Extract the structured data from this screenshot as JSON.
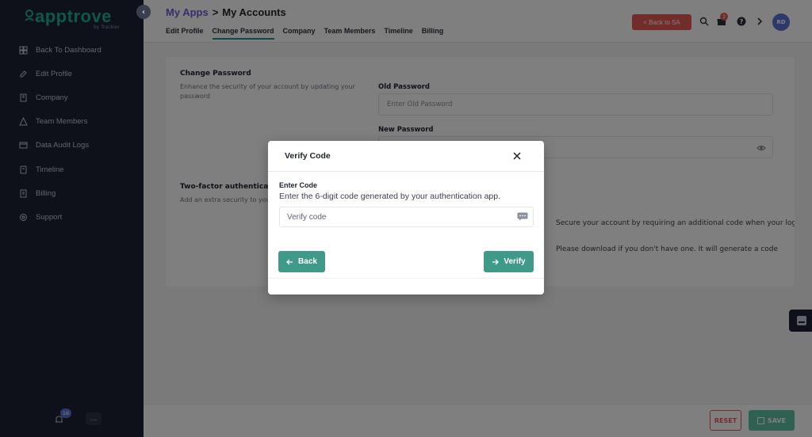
{
  "sidebar": {
    "logo_text": "apptrove",
    "logo_sub": "by Trackier",
    "items": [
      {
        "label": "Back To Dashboard",
        "icon": "dashboard-icon"
      },
      {
        "label": "Edit Profile",
        "icon": "edit-icon"
      },
      {
        "label": "Company",
        "icon": "building-icon"
      },
      {
        "label": "Team Members",
        "icon": "team-icon"
      },
      {
        "label": "Data Audit Logs",
        "icon": "audit-icon"
      },
      {
        "label": "Timeline",
        "icon": "timeline-icon"
      },
      {
        "label": "Billing",
        "icon": "billing-icon"
      },
      {
        "label": "Support",
        "icon": "support-icon"
      }
    ],
    "notification_count": "16",
    "more_label": "..."
  },
  "header": {
    "breadcrumb_link": "My Apps",
    "breadcrumb_sep": ">",
    "breadcrumb_current": "My Accounts",
    "tabs": [
      "Edit Profile",
      "Change Password",
      "Company",
      "Team Members",
      "Timeline",
      "Billing"
    ],
    "active_tab": "Change Password",
    "back_to_sa": "< Back to SA",
    "gift_badge": "2",
    "avatar_initials": "RD"
  },
  "change_password": {
    "title": "Change Password",
    "description": "Enhance the security of your account by updating your password",
    "old_password_label": "Old Password",
    "old_password_placeholder": "Enter Old Password",
    "new_password_label": "New Password",
    "new_password_value": "........"
  },
  "two_factor": {
    "title": "Two-factor authentication",
    "description": "Add an extra security to your account",
    "line1": "Secure your account by requiring an additional code when your log in on",
    "line2": "Please download if you don't have one. It will generate a code"
  },
  "footer": {
    "reset_label": "RESET",
    "save_label": "SAVE"
  },
  "modal": {
    "title": "Verify Code",
    "field_label": "Enter Code",
    "description": "Enter the 6-digit code generated by your authentication app.",
    "input_placeholder": "Verify code",
    "back_label": "Back",
    "verify_label": "Verify"
  },
  "colors": {
    "sidebar_bg": "#1d2235",
    "accent": "#3f9a8a",
    "brand_green": "#1fb08e",
    "danger": "#e45a55",
    "link_purple": "#6b5cd6"
  }
}
